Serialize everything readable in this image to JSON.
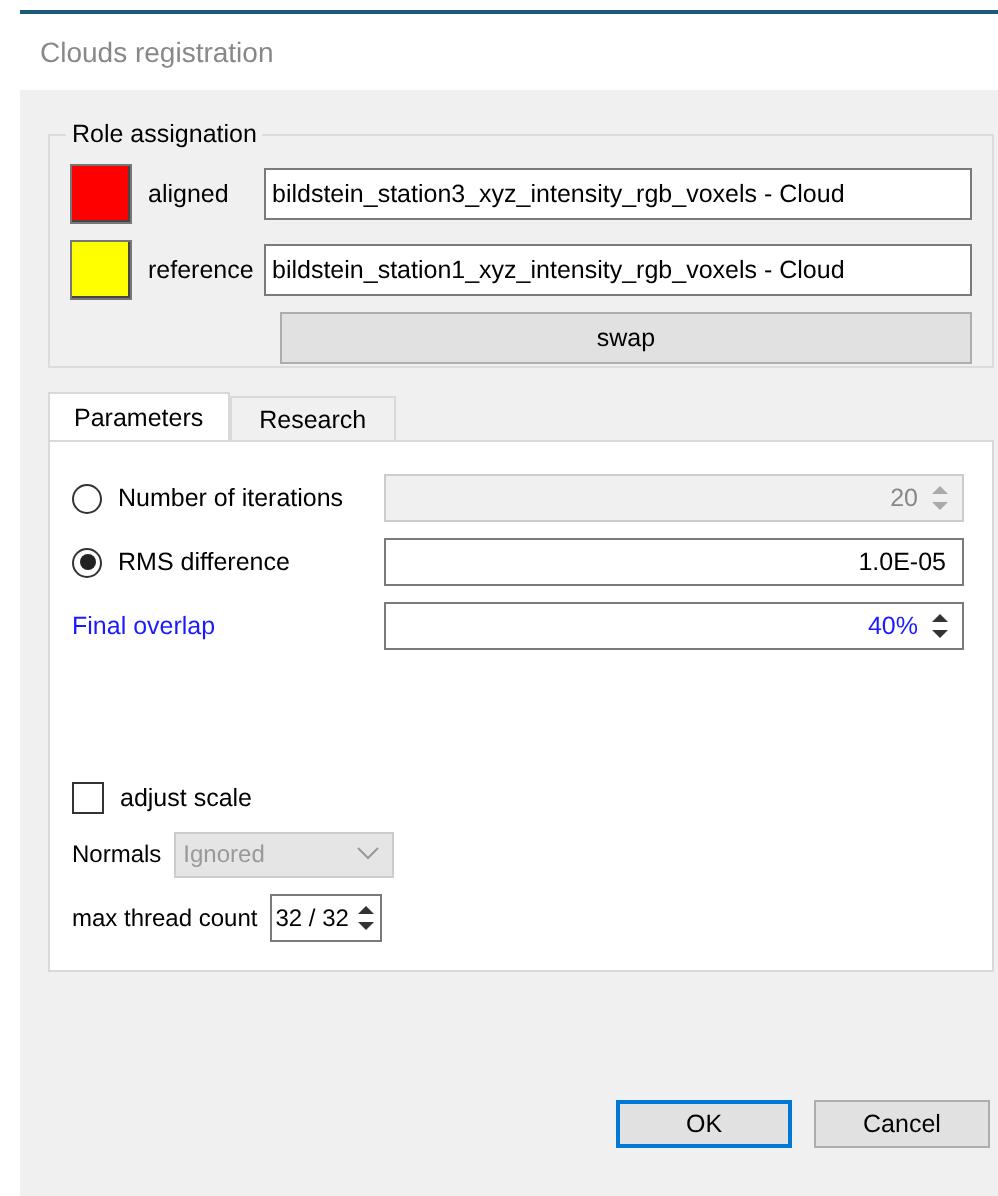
{
  "window": {
    "title": "Clouds registration"
  },
  "role_assignation": {
    "title": "Role assignation",
    "roles": [
      {
        "label": "aligned",
        "color": "#ff0000",
        "value": "bildstein_station3_xyz_intensity_rgb_voxels - Cloud"
      },
      {
        "label": "reference",
        "color": "#ffff00",
        "value": "bildstein_station1_xyz_intensity_rgb_voxels - Cloud"
      }
    ],
    "swap": "swap"
  },
  "tabs": [
    {
      "label": "Parameters",
      "selected": true
    },
    {
      "label": "Research",
      "selected": false
    }
  ],
  "parameters": {
    "stop_criteria": [
      {
        "label": "Number of iterations",
        "selected": false,
        "value": "20",
        "disabled": true
      },
      {
        "label": "RMS difference",
        "selected": true,
        "value": "1.0E-05",
        "disabled": false
      }
    ],
    "final_overlap": {
      "label": "Final overlap",
      "value": "40%"
    },
    "adjust_scale": {
      "label": "adjust scale",
      "checked": false
    },
    "normals": {
      "label": "Normals",
      "value": "Ignored",
      "disabled": true
    },
    "max_thread_count": {
      "label": "max thread count",
      "value": "32 / 32"
    }
  },
  "buttons": [
    {
      "label": "OK",
      "default": true
    },
    {
      "label": "Cancel",
      "default": false
    }
  ]
}
